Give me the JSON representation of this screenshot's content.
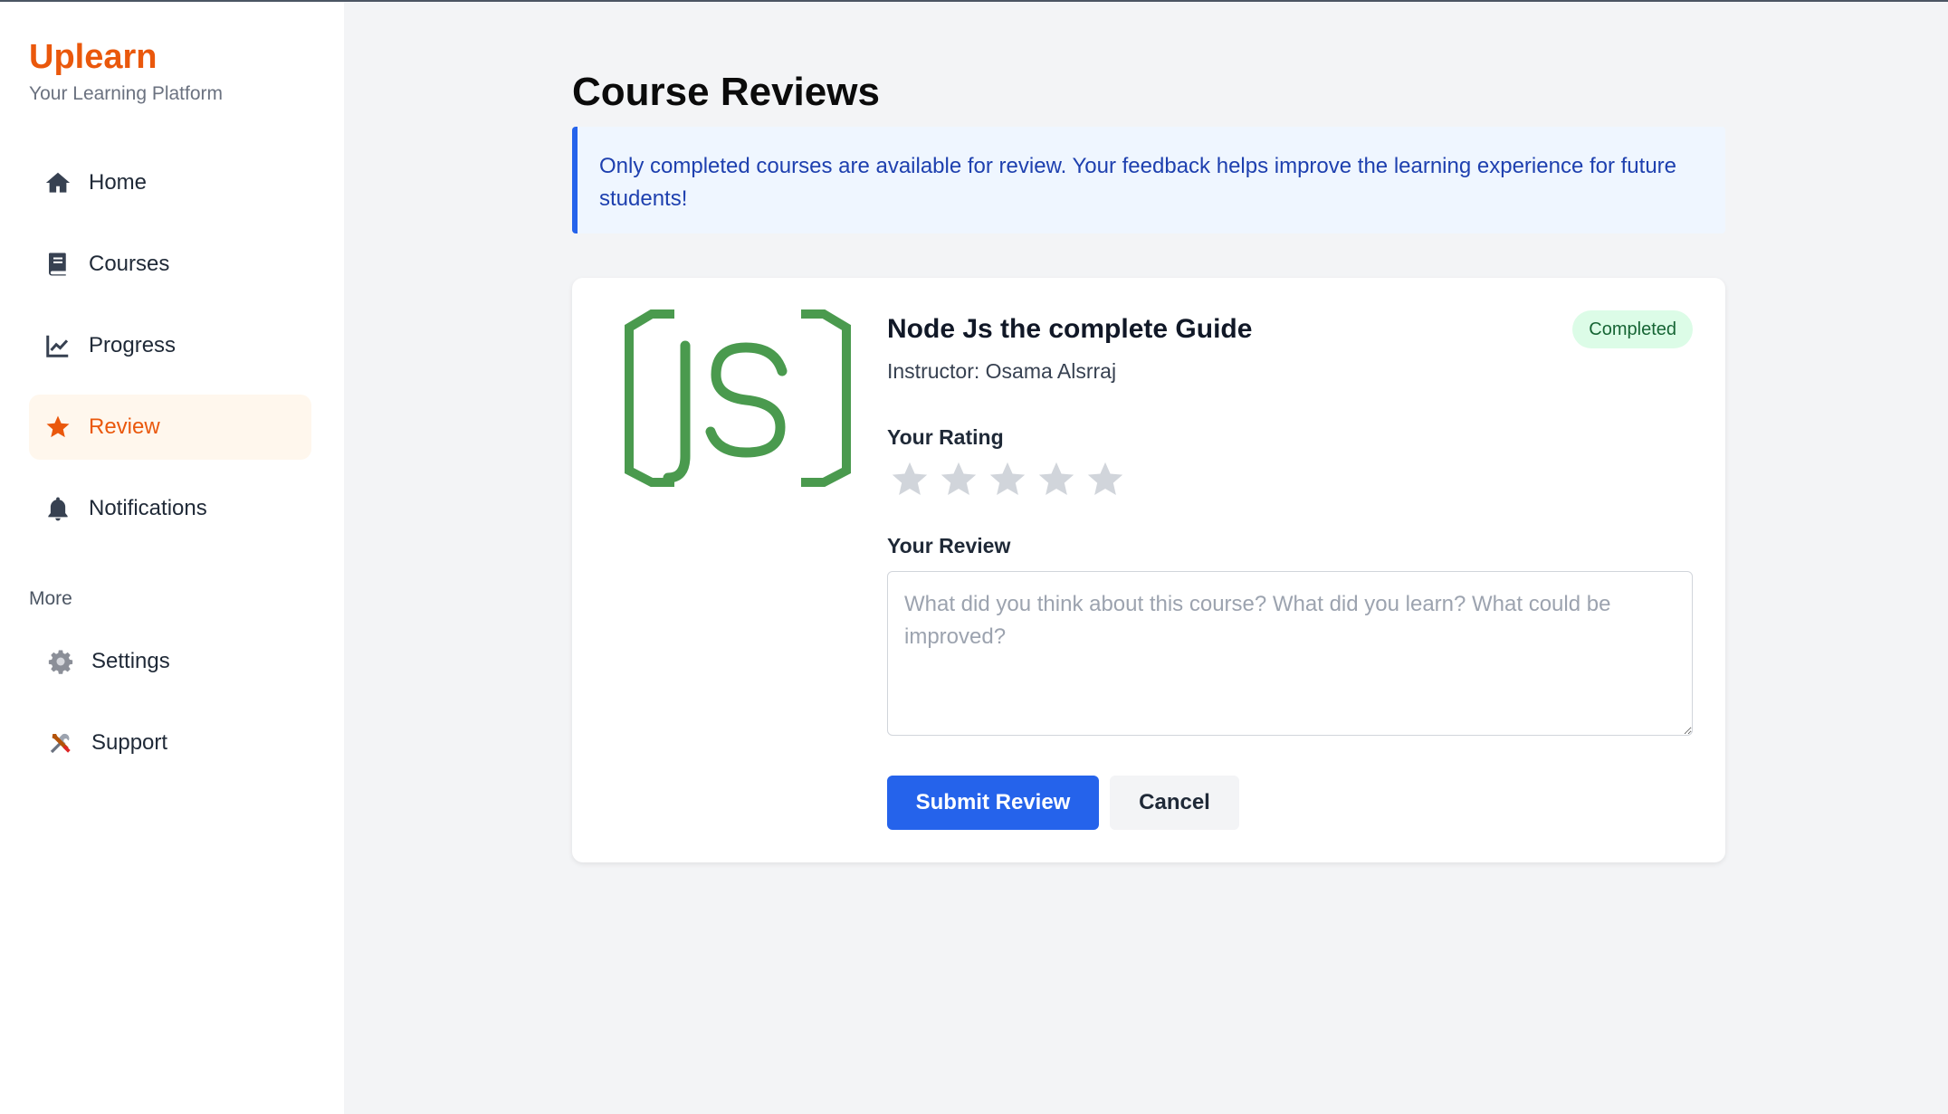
{
  "brand": {
    "name": "Uplearn",
    "tagline": "Your Learning Platform"
  },
  "nav": {
    "items": [
      {
        "label": "Home",
        "icon": "home-icon"
      },
      {
        "label": "Courses",
        "icon": "book-icon"
      },
      {
        "label": "Progress",
        "icon": "chart-line-icon"
      },
      {
        "label": "Review",
        "icon": "star-icon",
        "active": true
      },
      {
        "label": "Notifications",
        "icon": "bell-icon"
      }
    ],
    "more_label": "More",
    "more_items": [
      {
        "label": "Settings",
        "icon": "gear-icon"
      },
      {
        "label": "Support",
        "icon": "tools-icon"
      }
    ]
  },
  "page": {
    "title": "Course Reviews",
    "notice": "Only completed courses are available for review. Your feedback helps improve the learning experience for future students!"
  },
  "course": {
    "title": "Node Js the complete Guide",
    "instructor": "Instructor: Osama Alsrraj",
    "status": "Completed",
    "logo_icon": "nodejs-logo",
    "rating_label": "Your Rating",
    "rating_max": 5,
    "rating_value": 0,
    "review_label": "Your Review",
    "review_placeholder": "What did you think about this course? What did you learn? What could be improved?",
    "review_value": "",
    "submit_label": "Submit Review",
    "cancel_label": "Cancel"
  },
  "colors": {
    "accent": "#ea580c",
    "primary": "#2563eb",
    "success_bg": "#dcfce7",
    "success_text": "#166534",
    "star_empty": "#d1d5db",
    "logo_green": "#4a9a4e"
  }
}
